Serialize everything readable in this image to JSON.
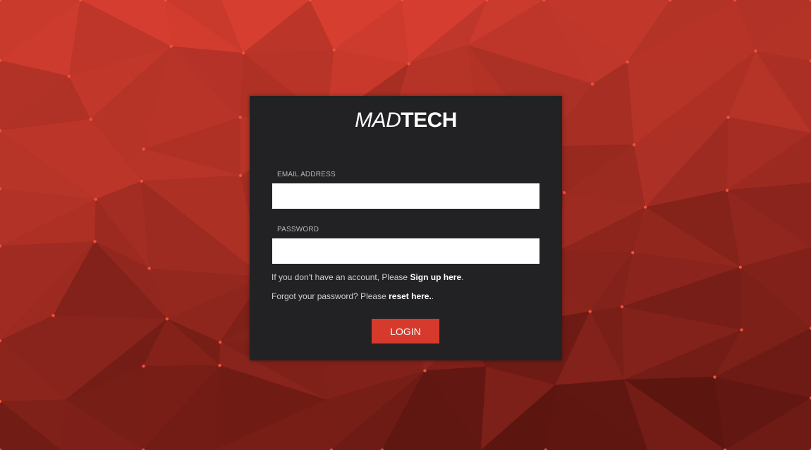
{
  "brand": {
    "logo_light": "MAD",
    "logo_bold": "TECH"
  },
  "form": {
    "email_label": "EMAIL ADDRESS",
    "email_value": "",
    "email_placeholder": "",
    "password_label": "PASSWORD",
    "password_value": "",
    "password_placeholder": "",
    "signup_prefix": "If you don't have an account, Please ",
    "signup_link": "Sign up here",
    "signup_suffix": ".",
    "reset_prefix": "Forgot your password? Please ",
    "reset_link": "reset here.",
    "reset_suffix": ".",
    "login_label": "LOGIN"
  },
  "colors": {
    "background_accent": "#c8342a",
    "panel": "#222224",
    "button": "#d63a2c"
  }
}
